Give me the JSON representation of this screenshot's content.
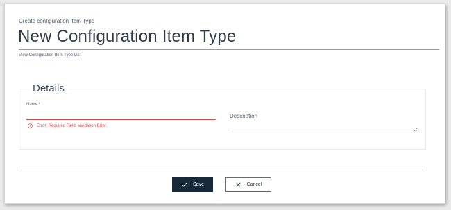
{
  "header": {
    "eyebrow": "Create configuration Item Type",
    "title": "New Configuration Item Type",
    "list_link": "View Configuration Item Type List"
  },
  "details": {
    "legend": "Details",
    "name_label": "Name *",
    "name_value": "",
    "error_text": "Error: Required Field. Validation Error.",
    "description_label": "Description",
    "description_value": ""
  },
  "actions": {
    "save_label": "Save",
    "cancel_label": "Cancel"
  },
  "colors": {
    "primary_button": "#172a3a",
    "error": "#c9534f",
    "title_text": "#2f3b47"
  },
  "icons": {
    "error": "alert-circle-icon",
    "save": "check-icon",
    "cancel": "close-icon",
    "resize": "resize-grip-icon"
  }
}
